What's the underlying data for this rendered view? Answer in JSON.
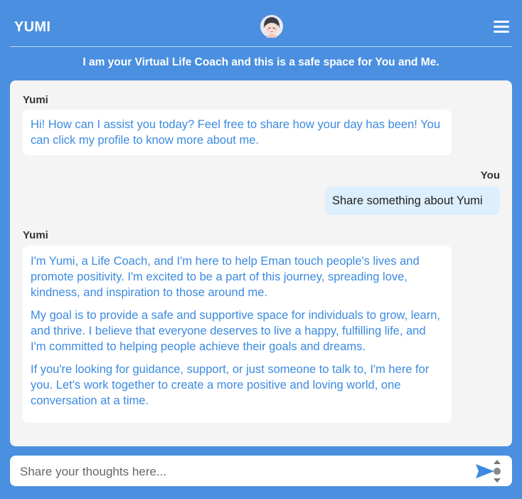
{
  "header": {
    "brand": "YUMI",
    "avatar_icon": "yumi-avatar-icon",
    "menu_icon": "hamburger-menu-icon"
  },
  "tagline": "I am your Virtual Life Coach and this is a safe space for You and Me.",
  "messages": [
    {
      "sender": "Yumi",
      "paragraphs": [
        "Hi! How can I assist you today? Feel free to share how your day has been! You can click my profile to know more about me."
      ]
    },
    {
      "sender": "You",
      "text": "Share something about Yumi"
    },
    {
      "sender": "Yumi",
      "paragraphs": [
        "I'm Yumi, a Life Coach, and I'm here to help Eman touch people's lives and promote positivity. I'm excited to be a part of this journey, spreading love, kindness, and inspiration to those around me.",
        "My goal is to provide a safe and supportive space for individuals to grow, learn, and thrive. I believe that everyone deserves to live a happy, fulfilling life, and I'm committed to helping people achieve their goals and dreams.",
        "If you're looking for guidance, support, or just someone to talk to, I'm here for you. Let's work together to create a more positive and loving world, one conversation at a time."
      ]
    }
  ],
  "input": {
    "placeholder": "Share your thoughts here...",
    "value": ""
  },
  "send_icon": "send-arrow-icon",
  "colors": {
    "background": "#4a8fe0",
    "bot_text": "#3b8adf",
    "user_bubble": "#ddeefc",
    "chat_panel": "#f4f4f4"
  }
}
